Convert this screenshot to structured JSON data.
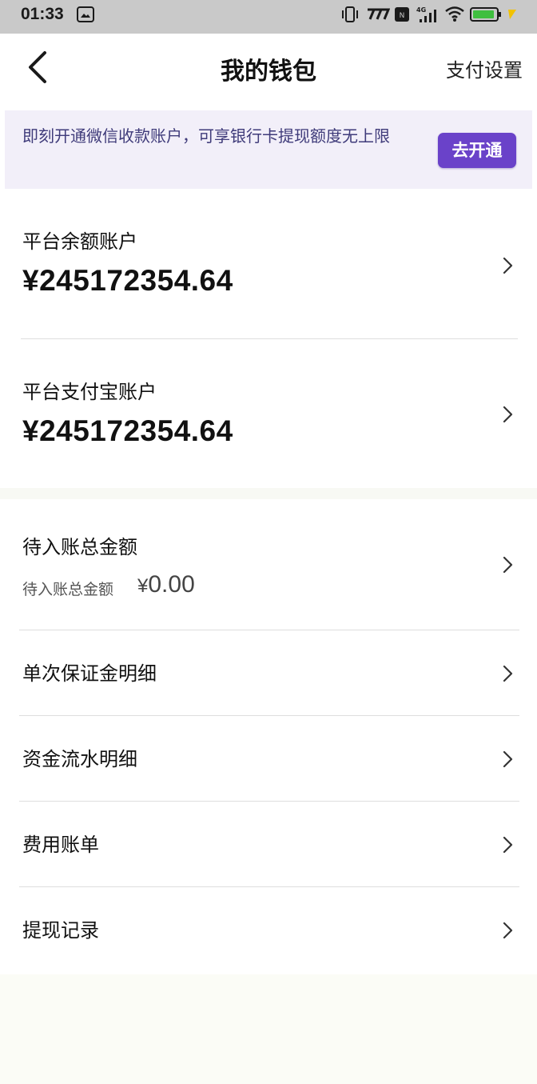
{
  "status_bar": {
    "time": "01:33",
    "icons": [
      "gallery-icon",
      "vibrate-icon",
      "network-speed-icon",
      "nfc-icon",
      "cellular-4g-icon",
      "wifi-icon",
      "battery-charging-icon"
    ]
  },
  "nav": {
    "title": "我的钱包",
    "back_icon": "chevron-left-icon",
    "settings_label": "支付设置"
  },
  "banner": {
    "text": "即刻开通微信收款账户，可享银行卡提现额度无上限",
    "button_label": "去开通",
    "button_color": "#6a42c9",
    "text_color": "#3f3b7a",
    "background": "#f2eff9"
  },
  "accounts": [
    {
      "label": "平台余额账户",
      "amount": "¥245172354.64"
    },
    {
      "label": "平台支付宝账户",
      "amount": "¥245172354.64"
    }
  ],
  "pending": {
    "label": "待入账总金额",
    "sub_label": "待入账总金额",
    "currency": "¥",
    "amount": "0.00"
  },
  "menu": [
    {
      "label": "单次保证金明细"
    },
    {
      "label": "资金流水明细"
    },
    {
      "label": "费用账单"
    },
    {
      "label": "提现记录"
    }
  ]
}
